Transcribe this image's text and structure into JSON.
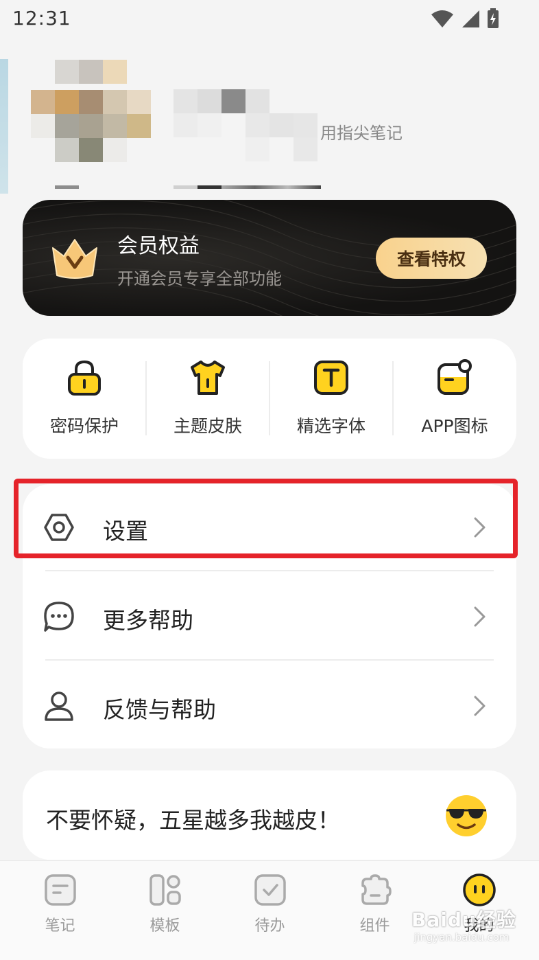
{
  "status_bar": {
    "time": "12:31"
  },
  "profile": {
    "tagline": "用指尖笔记"
  },
  "vip": {
    "title": "会员权益",
    "subtitle": "开通会员专享全部功能",
    "button": "查看特权"
  },
  "features": [
    {
      "label": "密码保护",
      "icon": "lock-icon"
    },
    {
      "label": "主题皮肤",
      "icon": "tshirt-icon"
    },
    {
      "label": "精选字体",
      "icon": "font-icon"
    },
    {
      "label": "APP图标",
      "icon": "app-icon"
    }
  ],
  "menu": [
    {
      "label": "设置",
      "icon": "settings-icon"
    },
    {
      "label": "更多帮助",
      "icon": "chat-icon"
    },
    {
      "label": "反馈与帮助",
      "icon": "user-icon"
    }
  ],
  "rating": {
    "text": "不要怀疑，五星越多我越皮！"
  },
  "nav": [
    {
      "label": "笔记",
      "icon": "note-icon"
    },
    {
      "label": "模板",
      "icon": "template-icon"
    },
    {
      "label": "待办",
      "icon": "todo-icon"
    },
    {
      "label": "组件",
      "icon": "widget-icon"
    },
    {
      "label": "我的",
      "icon": "profile-face-icon"
    }
  ],
  "watermark": {
    "brand": "Baidu经验",
    "sub": "jingyan.baidu.com"
  },
  "colors": {
    "accent": "#ffd21f",
    "highlight": "#e5232a",
    "vip_bg": "#1a1917",
    "vip_button": "#f9d28d"
  }
}
